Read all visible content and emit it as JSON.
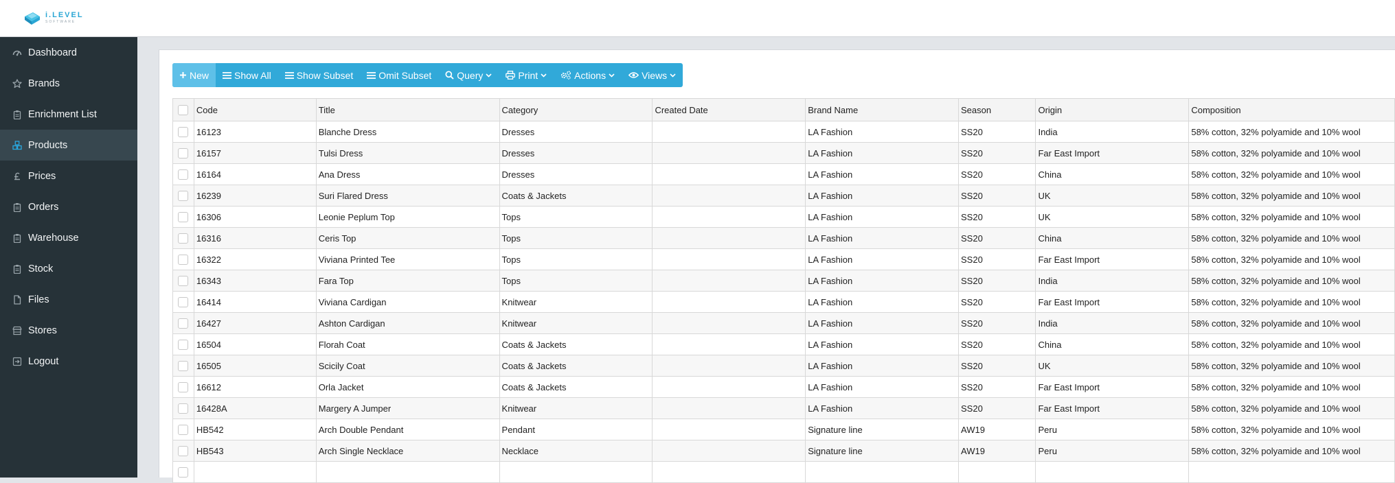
{
  "logo": {
    "name": "i.LEVEL",
    "sub": "SOFTWARE"
  },
  "sidebar": {
    "items": [
      {
        "label": "Dashboard",
        "icon": "dashboard-icon"
      },
      {
        "label": "Brands",
        "icon": "star-icon"
      },
      {
        "label": "Enrichment List",
        "icon": "clipboard-icon"
      },
      {
        "label": "Products",
        "icon": "cubes-icon",
        "active": true
      },
      {
        "label": "Prices",
        "icon": "pound-icon"
      },
      {
        "label": "Orders",
        "icon": "clipboard-icon"
      },
      {
        "label": "Warehouse",
        "icon": "clipboard-icon"
      },
      {
        "label": "Stock",
        "icon": "clipboard-icon"
      },
      {
        "label": "Files",
        "icon": "file-icon"
      },
      {
        "label": "Stores",
        "icon": "store-icon"
      },
      {
        "label": "Logout",
        "icon": "sign-out-icon"
      }
    ]
  },
  "toolbar": {
    "new": "New",
    "show_all": "Show All",
    "show_subset": "Show Subset",
    "omit_subset": "Omit Subset",
    "query": "Query",
    "print": "Print",
    "actions": "Actions",
    "views": "Views"
  },
  "table": {
    "columns": [
      "Code",
      "Title",
      "Category",
      "Created Date",
      "Brand Name",
      "Season",
      "Origin",
      "Composition"
    ],
    "rows": [
      [
        "16123",
        "Blanche Dress",
        "Dresses",
        "",
        "LA Fashion",
        "SS20",
        "India",
        "58% cotton, 32% polyamide and 10% wool"
      ],
      [
        "16157",
        "Tulsi Dress",
        "Dresses",
        "",
        "LA Fashion",
        "SS20",
        "Far East Import",
        "58% cotton, 32% polyamide and 10% wool"
      ],
      [
        "16164",
        "Ana Dress",
        "Dresses",
        "",
        "LA Fashion",
        "SS20",
        "China",
        "58% cotton, 32% polyamide and 10% wool"
      ],
      [
        "16239",
        "Suri Flared Dress",
        "Coats & Jackets",
        "",
        "LA Fashion",
        "SS20",
        "UK",
        "58% cotton, 32% polyamide and 10% wool"
      ],
      [
        "16306",
        "Leonie Peplum Top",
        "Tops",
        "",
        "LA Fashion",
        "SS20",
        "UK",
        "58% cotton, 32% polyamide and 10% wool"
      ],
      [
        "16316",
        "Ceris Top",
        "Tops",
        "",
        "LA Fashion",
        "SS20",
        "China",
        "58% cotton, 32% polyamide and 10% wool"
      ],
      [
        "16322",
        "Viviana Printed Tee",
        "Tops",
        "",
        "LA Fashion",
        "SS20",
        "Far East Import",
        "58% cotton, 32% polyamide and 10% wool"
      ],
      [
        "16343",
        "Fara Top",
        "Tops",
        "",
        "LA Fashion",
        "SS20",
        "India",
        "58% cotton, 32% polyamide and 10% wool"
      ],
      [
        "16414",
        "Viviana Cardigan",
        "Knitwear",
        "",
        "LA Fashion",
        "SS20",
        "Far East Import",
        "58% cotton, 32% polyamide and 10% wool"
      ],
      [
        "16427",
        "Ashton Cardigan",
        "Knitwear",
        "",
        "LA Fashion",
        "SS20",
        "India",
        "58% cotton, 32% polyamide and 10% wool"
      ],
      [
        "16504",
        "Florah Coat",
        "Coats & Jackets",
        "",
        "LA Fashion",
        "SS20",
        "China",
        "58% cotton, 32% polyamide and 10% wool"
      ],
      [
        "16505",
        "Scicily Coat",
        "Coats & Jackets",
        "",
        "LA Fashion",
        "SS20",
        "UK",
        "58% cotton, 32% polyamide and 10% wool"
      ],
      [
        "16612",
        "Orla Jacket",
        "Coats & Jackets",
        "",
        "LA Fashion",
        "SS20",
        "Far East Import",
        "58% cotton, 32% polyamide and 10% wool"
      ],
      [
        "16428A",
        "Margery A Jumper",
        "Knitwear",
        "",
        "LA Fashion",
        "SS20",
        "Far East Import",
        "58% cotton, 32% polyamide and 10% wool"
      ],
      [
        "HB542",
        "Arch Double Pendant",
        "Pendant",
        "",
        "Signature line",
        "AW19",
        "Peru",
        "58% cotton, 32% polyamide and 10% wool"
      ],
      [
        "HB543",
        "Arch Single Necklace",
        "Necklace",
        "",
        "Signature line",
        "AW19",
        "Peru",
        "58% cotton, 32% polyamide and 10% wool"
      ],
      [
        "",
        "",
        "",
        "",
        "",
        "",
        "",
        ""
      ]
    ]
  },
  "colors": {
    "sidebar_bg": "#263238",
    "sidebar_active": "#37474f",
    "toolbar_bg": "#31a9d9",
    "toolbar_primary": "#5ec0e8",
    "accent": "#29a8e0"
  }
}
